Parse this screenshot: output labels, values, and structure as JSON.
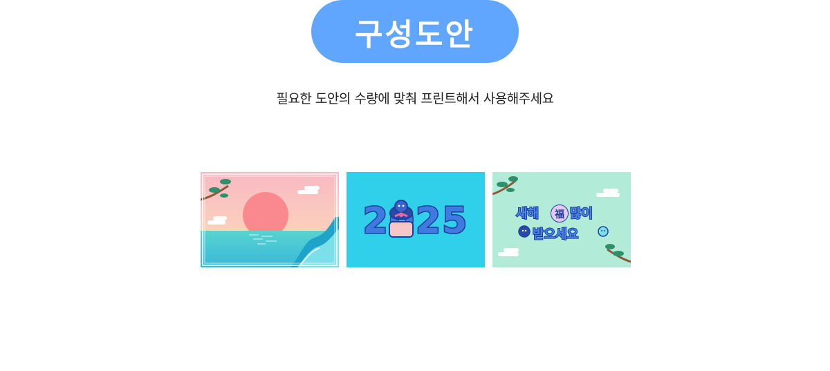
{
  "header": {
    "title": "구성도안"
  },
  "description": "필요한 도안의 수량에 맞춰 프린트해서 사용해주세요",
  "designs": [
    {
      "name": "sunrise-sea-design"
    },
    {
      "name": "year-2025-design",
      "year_text": "2025"
    },
    {
      "name": "new-year-greeting-design",
      "greeting_line1": "새해",
      "blessing_char": "福",
      "greeting_line1_end": "많이",
      "greeting_line2": "받으세요"
    }
  ],
  "colors": {
    "accent": "#60a5fe",
    "sunrise_bg": "#fcd6c3",
    "sea": "#4fd0cf",
    "year_bg": "#30d0ea",
    "greeting_bg": "#b2ecd9"
  }
}
